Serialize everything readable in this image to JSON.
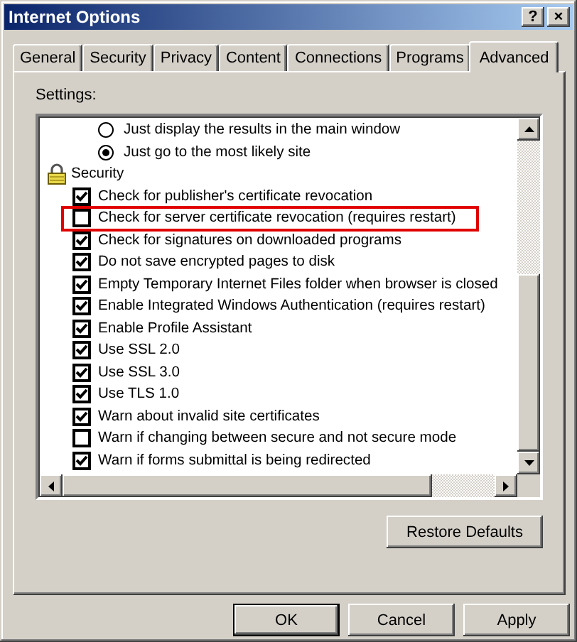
{
  "window": {
    "title": "Internet Options",
    "buttons": [
      "?",
      "×"
    ]
  },
  "tabs": [
    {
      "label": "General",
      "selected": false
    },
    {
      "label": "Security",
      "selected": false
    },
    {
      "label": "Privacy",
      "selected": false
    },
    {
      "label": "Content",
      "selected": false
    },
    {
      "label": "Connections",
      "selected": false
    },
    {
      "label": "Programs",
      "selected": false
    },
    {
      "label": "Advanced",
      "selected": true
    }
  ],
  "settings_label": "Settings:",
  "settings": [
    {
      "kind": "radio",
      "label": "Just display the results in the main window",
      "selected": false
    },
    {
      "kind": "radio",
      "label": "Just go to the most likely site",
      "selected": true
    },
    {
      "kind": "group",
      "label": "Security",
      "children": [
        {
          "kind": "checkbox",
          "label": "Check for publisher's certificate revocation",
          "checked": true,
          "highlighted": false
        },
        {
          "kind": "checkbox",
          "label": "Check for server certificate revocation (requires restart)",
          "checked": false,
          "highlighted": true
        },
        {
          "kind": "checkbox",
          "label": "Check for signatures on downloaded programs",
          "checked": true,
          "highlighted": false
        },
        {
          "kind": "checkbox",
          "label": "Do not save encrypted pages to disk",
          "checked": true,
          "highlighted": false
        },
        {
          "kind": "checkbox",
          "label": "Empty Temporary Internet Files folder when browser is closed",
          "checked": true,
          "highlighted": false
        },
        {
          "kind": "checkbox",
          "label": "Enable Integrated Windows Authentication (requires restart)",
          "checked": true,
          "highlighted": false
        },
        {
          "kind": "checkbox",
          "label": "Enable Profile Assistant",
          "checked": true,
          "highlighted": false
        },
        {
          "kind": "checkbox",
          "label": "Use SSL 2.0",
          "checked": true,
          "highlighted": false
        },
        {
          "kind": "checkbox",
          "label": "Use SSL 3.0",
          "checked": true,
          "highlighted": false
        },
        {
          "kind": "checkbox",
          "label": "Use TLS 1.0",
          "checked": true,
          "highlighted": false
        },
        {
          "kind": "checkbox",
          "label": "Warn about invalid site certificates",
          "checked": true,
          "highlighted": false
        },
        {
          "kind": "checkbox",
          "label": "Warn if changing between secure and not secure mode",
          "checked": false,
          "highlighted": false
        },
        {
          "kind": "checkbox",
          "label": "Warn if forms submittal is being redirected",
          "checked": true,
          "highlighted": false
        }
      ]
    }
  ],
  "restore_button": "Restore Defaults",
  "buttons": [
    {
      "label": "OK",
      "default": true
    },
    {
      "label": "Cancel",
      "default": false
    },
    {
      "label": "Apply",
      "default": false
    }
  ]
}
